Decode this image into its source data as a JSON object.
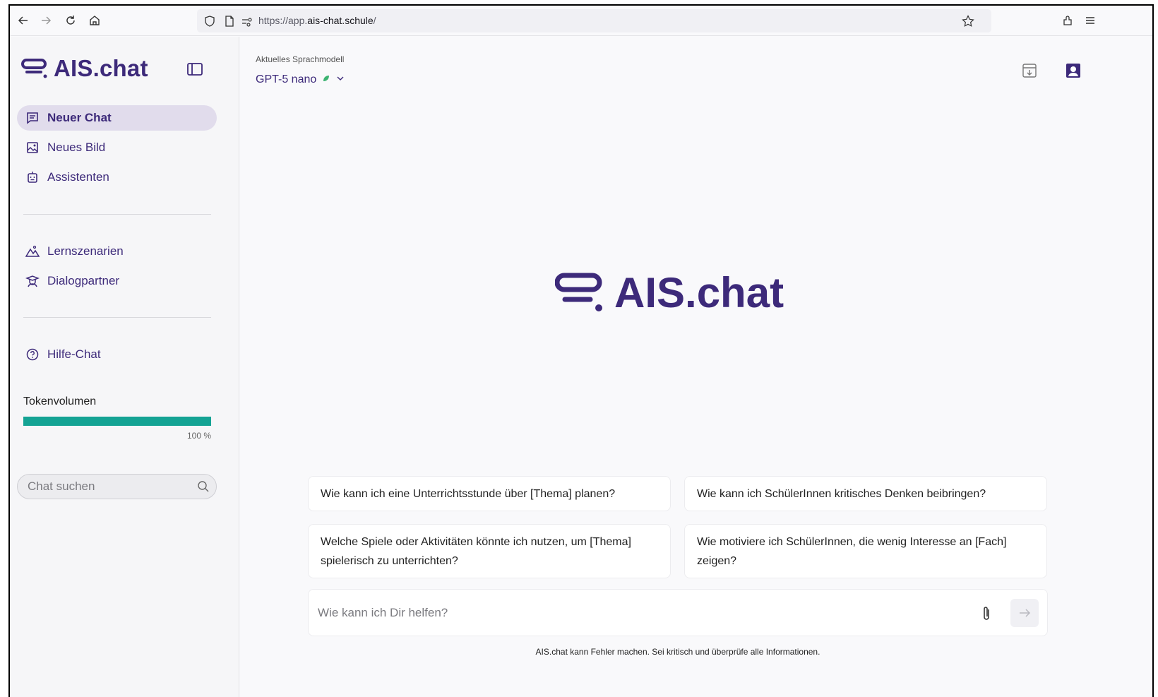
{
  "browser": {
    "url_prefix": "https://app.",
    "url_domain": "ais-chat.schule",
    "url_suffix": "/"
  },
  "sidebar": {
    "logo": "AIS.chat",
    "items_top": [
      {
        "label": "Neuer Chat",
        "icon": "chat-icon",
        "active": true
      },
      {
        "label": "Neues Bild",
        "icon": "image-icon"
      },
      {
        "label": "Assistenten",
        "icon": "robot-icon"
      }
    ],
    "items_mid": [
      {
        "label": "Lernszenarien",
        "icon": "mountains-icon"
      },
      {
        "label": "Dialogpartner",
        "icon": "graduate-icon"
      }
    ],
    "help": {
      "label": "Hilfe-Chat",
      "icon": "help-icon"
    },
    "token": {
      "label": "Tokenvolumen",
      "percent_label": "100 %",
      "fraction": 1.0
    },
    "search_placeholder": "Chat suchen"
  },
  "main": {
    "model_label": "Aktuelles Sprachmodell",
    "model_name": "GPT-5 nano",
    "logo": "AIS.chat",
    "suggestions": [
      "Wie kann ich eine Unterrichtsstunde über [Thema] planen?",
      "Wie kann ich SchülerInnen kritisches Denken beibringen?",
      "Welche Spiele oder Aktivitäten könnte ich nutzen, um [Thema] spielerisch zu unterrichten?",
      "Wie motiviere ich SchülerInnen, die wenig Interesse an [Fach] zeigen?"
    ],
    "input_placeholder": "Wie kann ich Dir helfen?",
    "disclaimer": "AIS.chat kann Fehler machen. Sei kritisch und überprüfe alle Informationen."
  },
  "colors": {
    "brand": "#3d2a7a",
    "token_bar": "#14a394",
    "active_bg": "#e1dcec"
  }
}
